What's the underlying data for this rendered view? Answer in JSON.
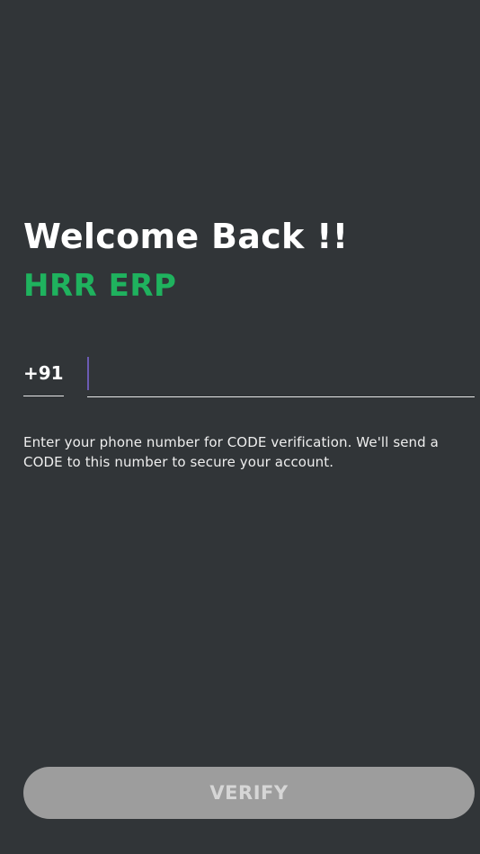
{
  "header": {
    "welcome_title": "Welcome Back !!",
    "brand_name": "HRR ERP"
  },
  "phone": {
    "country_code": "+91",
    "value": "",
    "placeholder": ""
  },
  "helper_text": "Enter your phone number for CODE verification. We'll send a CODE to this number to secure your account.",
  "actions": {
    "verify_label": "VERIFY",
    "verify_enabled": false
  },
  "colors": {
    "background": "#313538",
    "brand_accent": "#1fb25e",
    "caret": "#6b5bb4",
    "button_disabled": "#9d9d9d"
  }
}
